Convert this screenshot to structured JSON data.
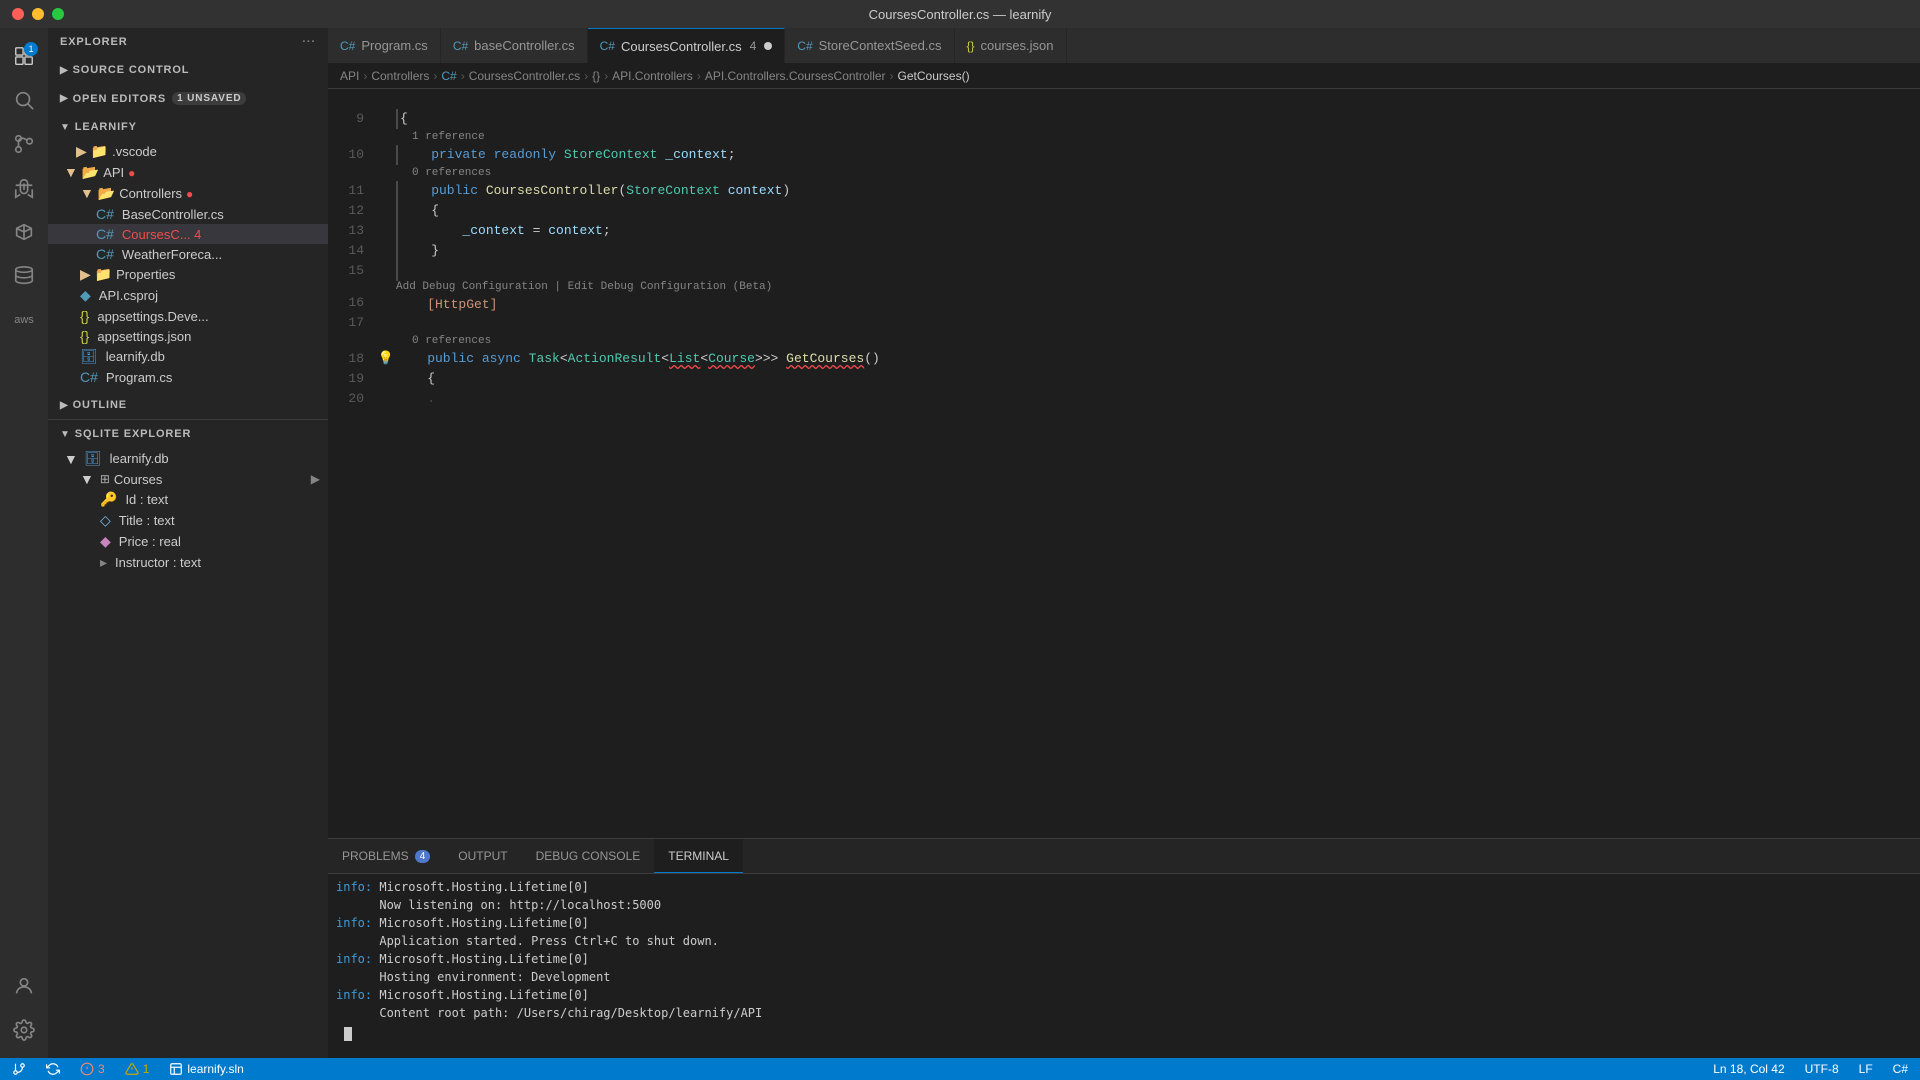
{
  "titlebar": {
    "title": "CoursesController.cs — learnify"
  },
  "tabs": [
    {
      "id": "program",
      "icon": "C#",
      "label": "Program.cs",
      "active": false,
      "dirty": false
    },
    {
      "id": "base",
      "icon": "C#",
      "label": "baseController.cs",
      "active": false,
      "dirty": false
    },
    {
      "id": "courses",
      "icon": "C#",
      "label": "CoursesController.cs",
      "active": true,
      "dirty": true,
      "errors": 4
    },
    {
      "id": "store",
      "icon": "C#",
      "label": "StoreContextSeed.cs",
      "active": false,
      "dirty": false
    },
    {
      "id": "json",
      "icon": "{}",
      "label": "courses.json",
      "active": false,
      "dirty": false
    }
  ],
  "breadcrumb": {
    "items": [
      "API",
      "Controllers",
      "C#",
      "CoursesController.cs",
      "{}",
      "API.Controllers",
      "API.Controllers.CoursesController",
      "GetCourses()"
    ]
  },
  "sidebar": {
    "explorer_label": "EXPLORER",
    "source_control_label": "SOURCE CONTROL",
    "open_editors_label": "OPEN EDITORS",
    "open_editors_badge": "1 UNSAVED",
    "project_name": "LEARNIFY",
    "outline_label": "OUTLINE",
    "sqlite_label": "SQLITE EXPLORER",
    "items": [
      {
        "label": ".vscode",
        "type": "folder",
        "indent": 1
      },
      {
        "label": "API",
        "type": "folder-open",
        "indent": 1,
        "error": true
      },
      {
        "label": "Controllers",
        "type": "folder-open",
        "indent": 2,
        "error": true
      },
      {
        "label": "BaseController.cs",
        "type": "cs",
        "indent": 3
      },
      {
        "label": "CoursesC... 4",
        "type": "cs",
        "indent": 3,
        "active": true,
        "error_count": 4
      },
      {
        "label": "WeatherForeca...",
        "type": "cs",
        "indent": 3
      },
      {
        "label": "Properties",
        "type": "folder",
        "indent": 2
      },
      {
        "label": "API.csproj",
        "type": "csproj",
        "indent": 2
      },
      {
        "label": "appsettings.Deve...",
        "type": "json",
        "indent": 2
      },
      {
        "label": "appsettings.json",
        "type": "json",
        "indent": 2
      },
      {
        "label": "learnify.db",
        "type": "db",
        "indent": 2
      },
      {
        "label": "Program.cs",
        "type": "cs",
        "indent": 2
      }
    ],
    "db_tree": {
      "db_name": "learnify.db",
      "tables": [
        {
          "name": "Courses",
          "columns": [
            {
              "name": "Id : text",
              "type": "key"
            },
            {
              "name": "Title : text",
              "type": "diamond"
            },
            {
              "name": "Price : real",
              "type": "bullet"
            },
            {
              "name": "Instructor : text",
              "type": "arrow"
            }
          ]
        }
      ]
    }
  },
  "editor": {
    "lines": [
      {
        "num": 9,
        "border": true,
        "content": "{",
        "tokens": [
          {
            "t": "op",
            "v": "{"
          }
        ]
      },
      {
        "num": 10,
        "border": true,
        "hint": "1 reference",
        "content": "    private readonly StoreContext _context;",
        "tokens": [
          {
            "t": "kw",
            "v": "    private"
          },
          {
            "t": "kw",
            "v": " readonly"
          },
          {
            "t": "type",
            "v": " StoreContext"
          },
          {
            "t": "var",
            "v": " _context"
          },
          {
            "t": "op",
            "v": ";"
          }
        ]
      },
      {
        "num": 11,
        "border": true,
        "hint": "0 references",
        "content": "    public CoursesController(StoreContext context)",
        "tokens": [
          {
            "t": "kw",
            "v": "    public"
          },
          {
            "t": "op",
            "v": " "
          },
          {
            "t": "fn",
            "v": "CoursesController"
          },
          {
            "t": "op",
            "v": "("
          },
          {
            "t": "type",
            "v": "StoreContext"
          },
          {
            "t": "var",
            "v": " context"
          },
          {
            "t": "op",
            "v": ")"
          }
        ]
      },
      {
        "num": 12,
        "border": true,
        "content": "    {",
        "tokens": [
          {
            "t": "op",
            "v": "    {"
          }
        ]
      },
      {
        "num": 13,
        "border": true,
        "content": "        _context = context;",
        "tokens": [
          {
            "t": "var",
            "v": "        _context"
          },
          {
            "t": "op",
            "v": " = "
          },
          {
            "t": "var",
            "v": "context"
          },
          {
            "t": "op",
            "v": ";"
          }
        ]
      },
      {
        "num": 14,
        "border": true,
        "content": "    }",
        "tokens": [
          {
            "t": "op",
            "v": "    }"
          }
        ]
      },
      {
        "num": 15,
        "border": true,
        "content": "",
        "tokens": []
      },
      {
        "num": 16,
        "border": false,
        "debug_hint": "Add Debug Configuration | Edit Debug Configuration (Beta)",
        "content": "    [HttpGet]",
        "tokens": [
          {
            "t": "str",
            "v": "    [HttpGet]"
          }
        ]
      },
      {
        "num": 17,
        "border": false,
        "content": "",
        "tokens": []
      },
      {
        "num": 18,
        "border": false,
        "hint": "0 references",
        "lightbulb": true,
        "content": "    public async Task<ActionResult<List<Course>>> GetCourses()",
        "tokens": [
          {
            "t": "kw",
            "v": "    public"
          },
          {
            "t": "kw",
            "v": " async"
          },
          {
            "t": "type",
            "v": " Task"
          },
          {
            "t": "op",
            "v": "<"
          },
          {
            "t": "type",
            "v": "ActionResult"
          },
          {
            "t": "op",
            "v": "<"
          },
          {
            "t": "type",
            "v": "List"
          },
          {
            "t": "op",
            "v": "<"
          },
          {
            "t": "type squiggle",
            "v": "Course"
          },
          {
            "t": "op",
            "v": ">>>"
          },
          {
            "t": "op",
            "v": " "
          },
          {
            "t": "fn squiggle",
            "v": "GetCourses"
          },
          {
            "t": "op",
            "v": "()"
          }
        ]
      },
      {
        "num": 19,
        "border": false,
        "content": "    {",
        "tokens": [
          {
            "t": "op",
            "v": "    {"
          }
        ]
      },
      {
        "num": 20,
        "border": false,
        "content": "",
        "tokens": []
      }
    ]
  },
  "panel": {
    "tabs": [
      "PROBLEMS",
      "OUTPUT",
      "DEBUG CONSOLE",
      "TERMINAL"
    ],
    "active_tab": "TERMINAL",
    "problems_count": 4,
    "terminal_lines": [
      {
        "type": "info",
        "prefix": "info:",
        "text": "  Microsoft.Hosting.Lifetime[0]"
      },
      {
        "type": "normal",
        "text": "      Now listening on: http://localhost:5000"
      },
      {
        "type": "info",
        "prefix": "info:",
        "text": "  Microsoft.Hosting.Lifetime[0]"
      },
      {
        "type": "normal",
        "text": "      Application started. Press Ctrl+C to shut down."
      },
      {
        "type": "info",
        "prefix": "info:",
        "text": "  Microsoft.Hosting.Lifetime[0]"
      },
      {
        "type": "normal",
        "text": "      Hosting environment: Development"
      },
      {
        "type": "info",
        "prefix": "info:",
        "text": "  Microsoft.Hosting.Lifetime[0]"
      },
      {
        "type": "normal",
        "text": "      Content root path: /Users/chirag/Desktop/learnify/API"
      }
    ]
  },
  "statusbar": {
    "errors": "3",
    "warnings": "1",
    "branch": "learnify.sln",
    "position": "Ln 18, Col 42"
  },
  "activity": {
    "icons": [
      "explorer",
      "search",
      "source-control",
      "debug",
      "extensions",
      "database",
      "aws"
    ],
    "bottom": [
      "user",
      "settings"
    ]
  }
}
